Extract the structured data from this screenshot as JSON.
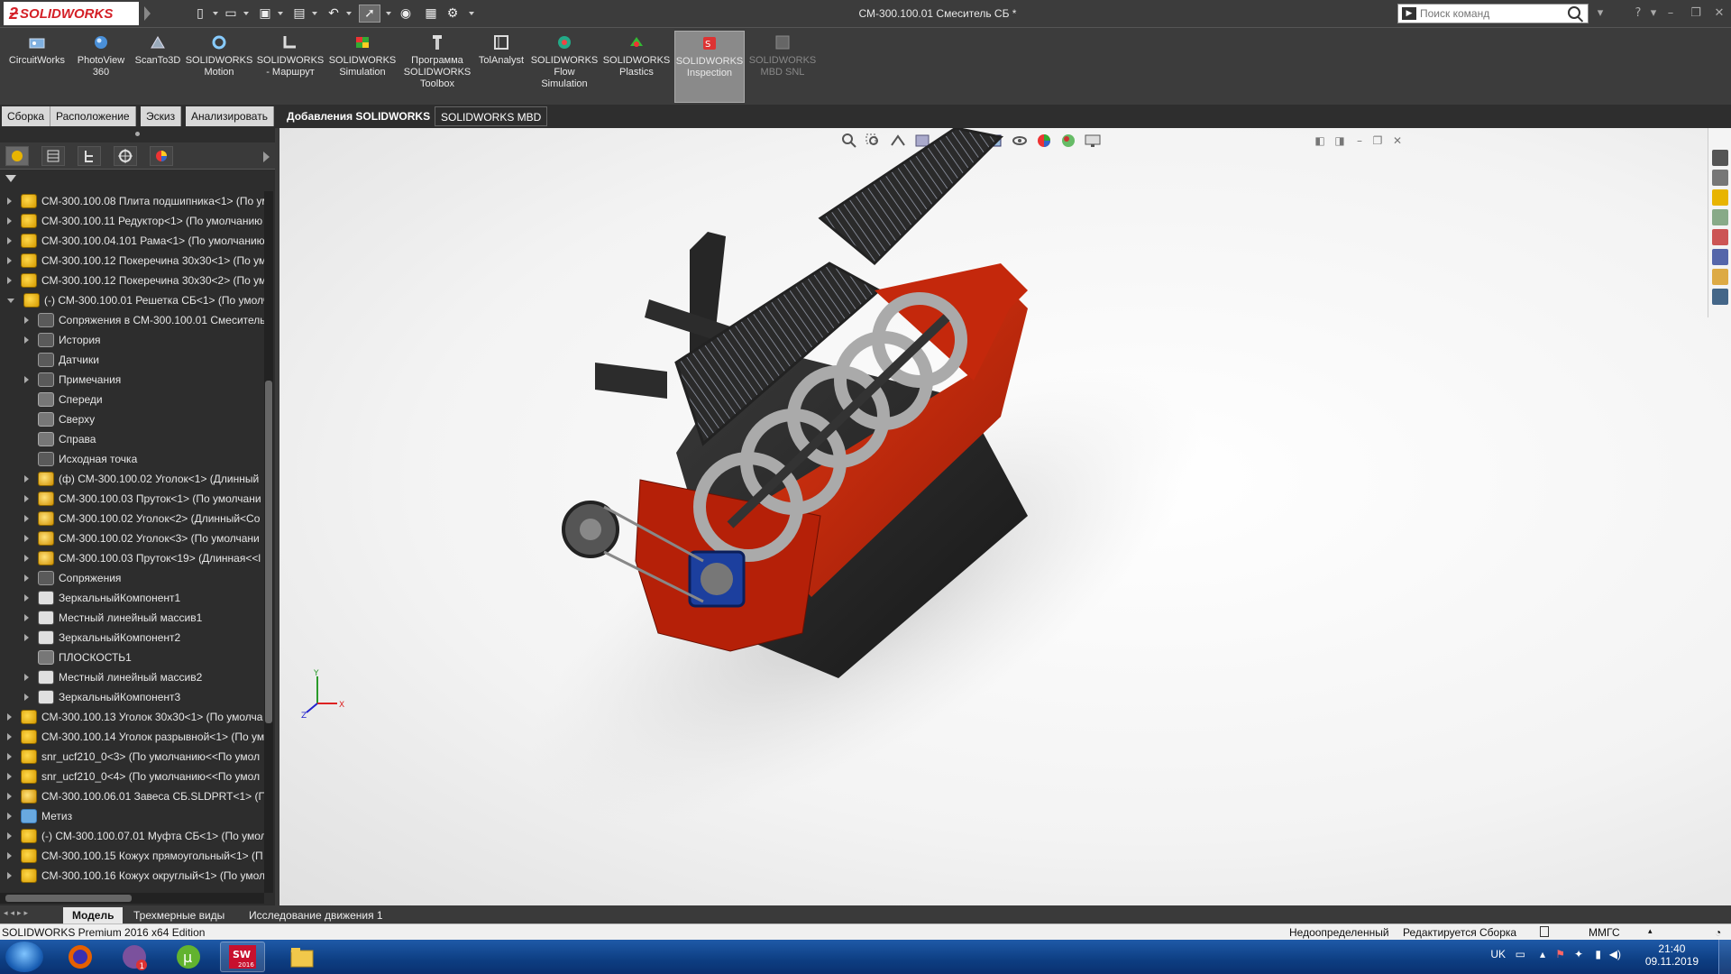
{
  "app": {
    "brand": "SOLIDWORKS",
    "document_title": "СМ-300.100.01 Смеситель СБ *",
    "search_placeholder": "Поиск команд"
  },
  "ribbon": [
    {
      "label": "CircuitWorks",
      "icon": "circuitworks-icon",
      "state": "normal"
    },
    {
      "label": "PhotoView\n360",
      "icon": "photoview-icon",
      "state": "normal"
    },
    {
      "label": "ScanTo3D",
      "icon": "scanto3d-icon",
      "state": "normal"
    },
    {
      "label": "SOLIDWORKS\nMotion",
      "icon": "motion-icon",
      "state": "normal"
    },
    {
      "label": "SOLIDWORKS\n- Маршрут",
      "icon": "routing-icon",
      "state": "normal"
    },
    {
      "label": "SOLIDWORKS\nSimulation",
      "icon": "simulation-icon",
      "state": "normal"
    },
    {
      "label": "Программа\nSOLIDWORKS\nToolbox",
      "icon": "toolbox-icon",
      "state": "normal"
    },
    {
      "label": "TolAnalyst",
      "icon": "tolanalyst-icon",
      "state": "normal"
    },
    {
      "label": "SOLIDWORKS\nFlow\nSimulation",
      "icon": "flow-simulation-icon",
      "state": "normal"
    },
    {
      "label": "SOLIDWORKS\nPlastics",
      "icon": "plastics-icon",
      "state": "normal"
    },
    {
      "label": "SOLIDWORKS\nInspection",
      "icon": "inspection-icon",
      "state": "active"
    },
    {
      "label": "SOLIDWORKS\nMBD SNL",
      "icon": "mbd-snl-icon",
      "state": "disabled"
    }
  ],
  "command_tabs": [
    "Сборка",
    "Расположение",
    "Эскиз",
    "Анализировать",
    "Добавления SOLIDWORKS",
    "SOLIDWORKS MBD"
  ],
  "active_command_tab": "Добавления SOLIDWORKS",
  "tree": [
    {
      "label": "СМ-300.100.08 Плита подшипника<1> (По ум",
      "level": 0,
      "icon": "asm",
      "exp": "closed"
    },
    {
      "label": "СМ-300.100.11 Редуктор<1> (По умолчанию",
      "level": 0,
      "icon": "asm",
      "exp": "closed"
    },
    {
      "label": "СМ-300.100.04.101 Рама<1> (По умолчанию",
      "level": 0,
      "icon": "asm",
      "exp": "closed"
    },
    {
      "label": "СМ-300.100.12 Покеречина 30х30<1> (По ум",
      "level": 0,
      "icon": "asm",
      "exp": "closed"
    },
    {
      "label": "СМ-300.100.12 Покеречина 30х30<2> (По ум",
      "level": 0,
      "icon": "asm",
      "exp": "closed"
    },
    {
      "label": "(-) СМ-300.100.01 Решетка СБ<1> (По умолч",
      "level": 0,
      "icon": "asm",
      "exp": "open"
    },
    {
      "label": "Сопряжения в СМ-300.100.01 Смеситель",
      "level": 1,
      "icon": "plain",
      "exp": "closed"
    },
    {
      "label": "История",
      "level": 1,
      "icon": "plain",
      "exp": "closed"
    },
    {
      "label": "Датчики",
      "level": 1,
      "icon": "plain",
      "exp": "none"
    },
    {
      "label": "Примечания",
      "level": 1,
      "icon": "plain",
      "exp": "closed"
    },
    {
      "label": "Спереди",
      "level": 1,
      "icon": "plane",
      "exp": "none"
    },
    {
      "label": "Сверху",
      "level": 1,
      "icon": "plane",
      "exp": "none"
    },
    {
      "label": "Справа",
      "level": 1,
      "icon": "plane",
      "exp": "none"
    },
    {
      "label": "Исходная точка",
      "level": 1,
      "icon": "plain",
      "exp": "none"
    },
    {
      "label": "(ф) СМ-300.100.02 Уголок<1> (Длинный",
      "level": 1,
      "icon": "part",
      "exp": "closed"
    },
    {
      "label": "СМ-300.100.03 Пруток<1> (По умолчани",
      "level": 1,
      "icon": "part",
      "exp": "closed"
    },
    {
      "label": "СМ-300.100.02 Уголок<2> (Длинный<Co",
      "level": 1,
      "icon": "part",
      "exp": "closed"
    },
    {
      "label": "СМ-300.100.02 Уголок<3> (По умолчани",
      "level": 1,
      "icon": "part",
      "exp": "closed"
    },
    {
      "label": "СМ-300.100.03 Пруток<19> (Длинная<<l",
      "level": 1,
      "icon": "part",
      "exp": "closed"
    },
    {
      "label": "Сопряжения",
      "level": 1,
      "icon": "plain",
      "exp": "closed"
    },
    {
      "label": "ЗеркальныйКомпонент1",
      "level": 1,
      "icon": "mirror",
      "exp": "closed"
    },
    {
      "label": "Местный линейный массив1",
      "level": 1,
      "icon": "mirror",
      "exp": "closed"
    },
    {
      "label": "ЗеркальныйКомпонент2",
      "level": 1,
      "icon": "mirror",
      "exp": "closed"
    },
    {
      "label": "ПЛОСКОСТЬ1",
      "level": 1,
      "icon": "plane",
      "exp": "none"
    },
    {
      "label": "Местный линейный массив2",
      "level": 1,
      "icon": "mirror",
      "exp": "closed"
    },
    {
      "label": "ЗеркальныйКомпонент3",
      "level": 1,
      "icon": "mirror",
      "exp": "closed"
    },
    {
      "label": "СМ-300.100.13 Уголок 30х30<1> (По умолча",
      "level": 0,
      "icon": "asm",
      "exp": "closed"
    },
    {
      "label": "СМ-300.100.14 Уголок  разрывной<1> (По ум",
      "level": 0,
      "icon": "asm",
      "exp": "closed"
    },
    {
      "label": "snr_ucf210_0<3> (По умолчанию<<По умол",
      "level": 0,
      "icon": "asm",
      "exp": "closed"
    },
    {
      "label": "snr_ucf210_0<4> (По умолчанию<<По умол",
      "level": 0,
      "icon": "asm",
      "exp": "closed"
    },
    {
      "label": "СМ-300.100.06.01 Завеса СБ.SLDPRT<1> (По у",
      "level": 0,
      "icon": "part",
      "exp": "closed"
    },
    {
      "label": "Метиз",
      "level": 0,
      "icon": "folder",
      "exp": "closed"
    },
    {
      "label": "(-) СМ-300.100.07.01 Муфта СБ<1> (По умол",
      "level": 0,
      "icon": "asm",
      "exp": "closed"
    },
    {
      "label": "СМ-300.100.15 Кожух прямоугольный<1> (П",
      "level": 0,
      "icon": "asm",
      "exp": "closed"
    },
    {
      "label": "СМ-300.100.16 Кожух округлый<1> (По умол",
      "level": 0,
      "icon": "asm",
      "exp": "closed"
    }
  ],
  "bottom_tabs": [
    "Модель",
    "Трехмерные виды",
    "Исследование движения 1"
  ],
  "active_bottom_tab": "Модель",
  "status": {
    "product": "SOLIDWORKS Premium 2016 x64 Edition",
    "definition": "Недоопределенный",
    "mode": "Редактируется Сборка",
    "units": "ММГС"
  },
  "taskbar": {
    "apps": [
      "start-orb",
      "firefox-icon",
      "viber-icon",
      "utorrent-icon",
      "solidworks-2016-icon",
      "file-explorer-icon"
    ],
    "lang": "UK",
    "time": "21:40",
    "date": "09.11.2019",
    "viber_badge": "1",
    "sw_badge": "2016"
  },
  "triad": {
    "x": "X",
    "y": "Y",
    "z": "Z"
  },
  "colors": {
    "brand_red": "#d42027",
    "machine_red": "#c2260f",
    "machine_dark": "#2a2a2a",
    "ui_dark": "#3c3c3c"
  }
}
